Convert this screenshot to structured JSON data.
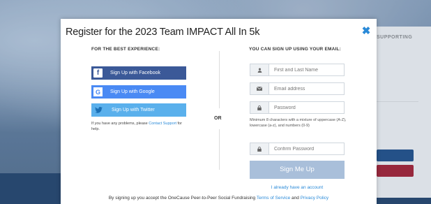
{
  "background": {
    "card_title": "SUPPORTING"
  },
  "modal": {
    "title": "Register for the 2023 Team IMPACT All In 5k",
    "close_icon": "✖"
  },
  "left": {
    "heading": "FOR THE BEST EXPERIENCE:",
    "facebook_label": "Sign Up with Facebook",
    "facebook_icon": "f",
    "google_label": "Sign Up with Google",
    "google_icon": "G",
    "twitter_label": "Sign Up with Twitter",
    "twitter_icon": "🐦",
    "help_prefix": "If you have any problems, please ",
    "help_link": "Contact Support",
    "help_suffix": " for help."
  },
  "or_label": "OR",
  "right": {
    "heading": "YOU CAN SIGN UP USING YOUR EMAIL:",
    "name_placeholder": "First and Last Name",
    "email_placeholder": "Email address",
    "password_placeholder": "Password",
    "password_hint": "Minimum 8 characters with a mixture of uppercase (A-Z), lowercase (a-z), and numbers (0-9)",
    "confirm_placeholder": "Confirm Password",
    "signup_label": "Sign Me Up",
    "have_account": "I already have an account"
  },
  "terms": {
    "prefix": "By signing up you accept the OneCause Peer-to-Peer Social Fundraising ",
    "tos": "Terms of Service",
    "and": " and ",
    "privacy": "Privacy Policy"
  },
  "icons": {
    "person": "person-icon",
    "envelope": "envelope-icon",
    "lock": "lock-icon"
  }
}
